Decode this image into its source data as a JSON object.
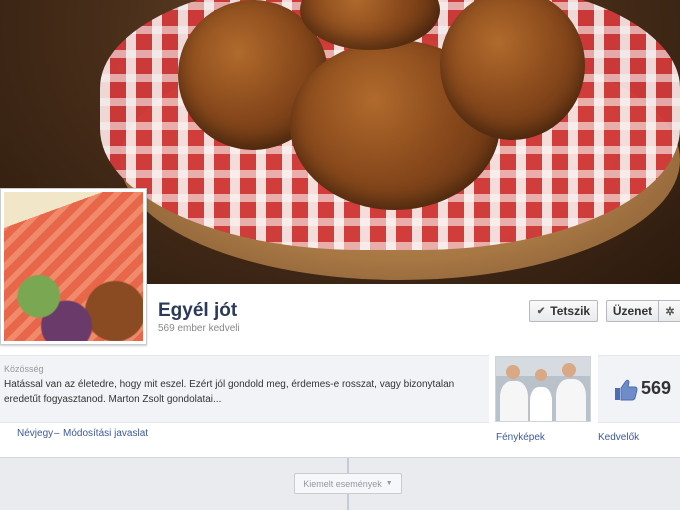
{
  "page": {
    "name": "Egyél jót",
    "likes_subtitle": "569 ember kedveli",
    "category": "Közösség",
    "about": "Hatással van az életedre, hogy mit eszel. Ezért jól gondold meg, érdemes-e rosszat, vagy bizonytalan eredetűt fogyasztanod. Marton Zsolt gondolatai...",
    "like_count": "569"
  },
  "actions": {
    "like_label": "Tetszik",
    "message_label": "Üzenet",
    "like_icon": "checkmark-icon",
    "settings_icon": "gear-icon"
  },
  "links": {
    "about": "Névjegy",
    "separator": "–",
    "suggest_edit": "Módosítási javaslat",
    "photos": "Fényképek",
    "likers": "Kedvelők"
  },
  "timeline": {
    "highlights_label": "Kiemelt események",
    "caret_icon": "chevron-down-icon"
  },
  "colors": {
    "link": "#3b5998",
    "name": "#2b3a5c",
    "like_icon": "#4a6db5"
  }
}
